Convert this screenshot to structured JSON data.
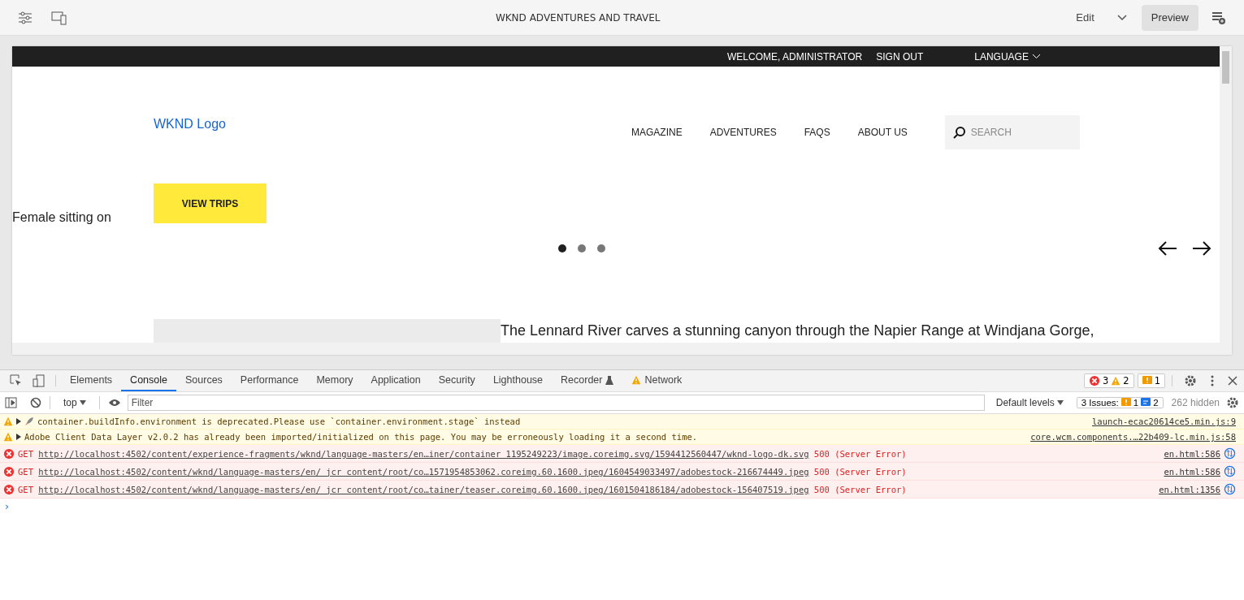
{
  "editor_bar": {
    "title": "WKND ADVENTURES AND TRAVEL",
    "mode": "Edit",
    "preview": "Preview"
  },
  "site": {
    "utility": {
      "welcome": "WELCOME, ADMINISTRATOR",
      "sign_out": "SIGN OUT",
      "language": "LANGUAGE"
    },
    "logo_alt": "WKND Logo",
    "nav": [
      "MAGAZINE",
      "ADVENTURES",
      "FAQS",
      "ABOUT US"
    ],
    "search": {
      "placeholder": "SEARCH"
    },
    "hero_alt": "Female sitting on",
    "cta": "VIEW TRIPS",
    "dots": [
      {
        "selected": true
      },
      {
        "selected": false
      },
      {
        "selected": false
      }
    ],
    "teaser_alt": "The Lennard River carves a stunning canyon through the Napier Range at Windjana Gorge,"
  },
  "devtools": {
    "tabs": [
      {
        "label": "Elements",
        "selected": false
      },
      {
        "label": "Console",
        "selected": true
      },
      {
        "label": "Sources",
        "selected": false
      },
      {
        "label": "Performance",
        "selected": false
      },
      {
        "label": "Memory",
        "selected": false
      },
      {
        "label": "Application",
        "selected": false
      },
      {
        "label": "Security",
        "selected": false
      },
      {
        "label": "Lighthouse",
        "selected": false
      },
      {
        "label": "Recorder",
        "selected": false,
        "flask": true
      },
      {
        "label": "Network",
        "selected": false,
        "warning": true
      }
    ],
    "counts": {
      "errors": "3",
      "warnings": "2",
      "issues": "1"
    },
    "context": "top",
    "filter_placeholder": "Filter",
    "levels": "Default levels",
    "issues_label": "3 Issues:",
    "issues_warn": "1",
    "issues_info": "2",
    "hidden": "262 hidden",
    "messages": [
      {
        "kind": "warning",
        "rocket": true,
        "text": "container.buildInfo.environment is deprecated.Please use `container.environment.stage` instead",
        "source": "launch-ecac20614ce5.min.js:9"
      },
      {
        "kind": "warning",
        "rocket": false,
        "text": "Adobe Client Data Layer v2.0.2 has already been imported/initialized on this page. You may be erroneously loading it a second time.",
        "source": "core.wcm.components.…22b409-lc.min.js:58"
      },
      {
        "kind": "error",
        "method": "GET",
        "url": "http://localhost:4502/content/experience-fragments/wknd/language-masters/en…iner/container_1195249223/image.coreimg.svg/1594412560447/wknd-logo-dk.svg",
        "status": "500 (Server Error)",
        "source": "en.html:586"
      },
      {
        "kind": "error",
        "method": "GET",
        "url": "http://localhost:4502/content/wknd/language-masters/en/_jcr_content/root/co…1571954853062.coreimg.60.1600.jpeg/1604549033497/adobestock-216674449.jpeg",
        "status": "500 (Server Error)",
        "source": "en.html:586"
      },
      {
        "kind": "error",
        "method": "GET",
        "url": "http://localhost:4502/content/wknd/language-masters/en/_jcr_content/root/co…tainer/teaser.coreimg.60.1600.jpeg/1601504186184/adobestock-156407519.jpeg",
        "status": "500 (Server Error)",
        "source": "en.html:1356"
      }
    ],
    "prompt": "›"
  }
}
